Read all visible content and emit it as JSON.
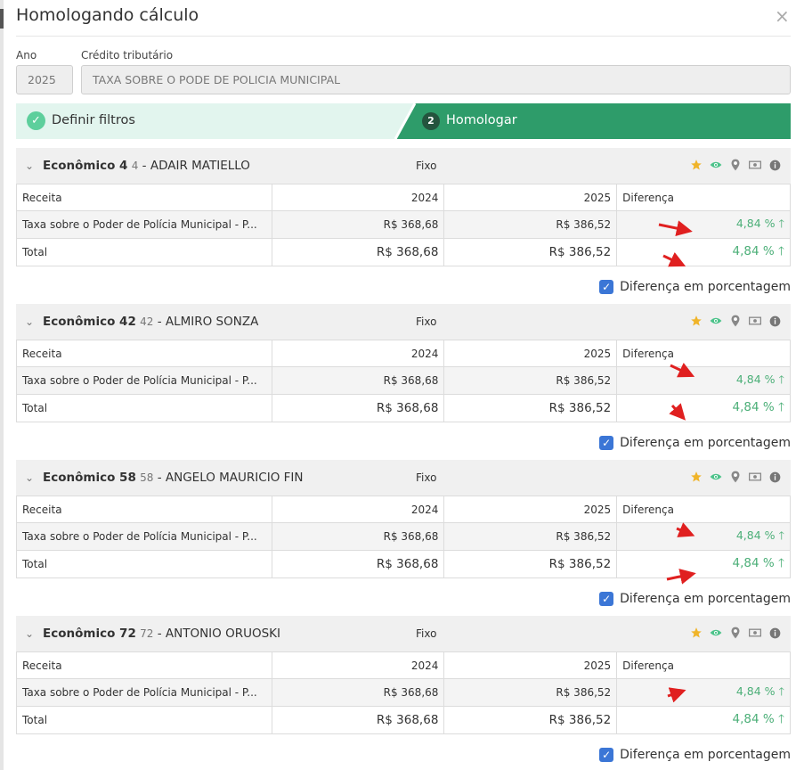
{
  "dialog": {
    "title": "Homologando cálculo",
    "close_glyph": "×"
  },
  "filters": {
    "year_label": "Ano",
    "year_value": "2025",
    "credit_label": "Crédito tributário",
    "credit_value": "TAXA SOBRE O PODE DE POLICIA MUNICIPAL"
  },
  "steps": {
    "step1_label": "Definir filtros",
    "step1_icon": "check-icon",
    "step2_number": "2",
    "step2_label": "Homologar"
  },
  "columns": {
    "receita": "Receita",
    "year1": "2024",
    "year2": "2025",
    "diff": "Diferença"
  },
  "sections": [
    {
      "name": "Econômico 4",
      "num": "4",
      "owner": " - ADAIR MATIELLO",
      "type": "Fixo",
      "row_label": "Taxa sobre o Poder de Polícia Municipal - P...",
      "row_v1": "R$ 368,68",
      "row_v2": "R$ 386,52",
      "row_diff": "4,84 %",
      "total_label": "Total",
      "total_v1": "R$ 368,68",
      "total_v2": "R$ 386,52",
      "total_diff": "4,84 %",
      "checkbox_label": "Diferença em porcentagem"
    },
    {
      "name": "Econômico 42",
      "num": "42",
      "owner": " - ALMIRO SONZA",
      "type": "Fixo",
      "row_label": "Taxa sobre o Poder de Polícia Municipal - P...",
      "row_v1": "R$ 368,68",
      "row_v2": "R$ 386,52",
      "row_diff": "4,84 %",
      "total_label": "Total",
      "total_v1": "R$ 368,68",
      "total_v2": "R$ 386,52",
      "total_diff": "4,84 %",
      "checkbox_label": "Diferença em porcentagem"
    },
    {
      "name": "Econômico 58",
      "num": "58",
      "owner": " - ANGELO MAURICIO FIN",
      "type": "Fixo",
      "row_label": "Taxa sobre o Poder de Polícia Municipal - P...",
      "row_v1": "R$ 368,68",
      "row_v2": "R$ 386,52",
      "row_diff": "4,84 %",
      "total_label": "Total",
      "total_v1": "R$ 368,68",
      "total_v2": "R$ 386,52",
      "total_diff": "4,84 %",
      "checkbox_label": "Diferença em porcentagem"
    },
    {
      "name": "Econômico 72",
      "num": "72",
      "owner": " - ANTONIO ORUOSKI",
      "type": "Fixo",
      "row_label": "Taxa sobre o Poder de Polícia Municipal - P...",
      "row_v1": "R$ 368,68",
      "row_v2": "R$ 386,52",
      "row_diff": "4,84 %",
      "total_label": "Total",
      "total_v1": "R$ 368,68",
      "total_v2": "R$ 386,52",
      "total_diff": "4,84 %",
      "checkbox_label": "Diferença em porcentagem"
    }
  ],
  "colors": {
    "step1_bg": "#e2f5ee",
    "step2_bg": "#2e9c6a",
    "positive_green": "#4caf78",
    "star": "#f0b429",
    "eye": "#4cc38a",
    "checkbox": "#3b76d6",
    "annotation_arrow": "#e02020"
  },
  "header_icons": [
    "star-icon",
    "eye-icon",
    "map-pin-icon",
    "money-icon",
    "info-icon"
  ]
}
